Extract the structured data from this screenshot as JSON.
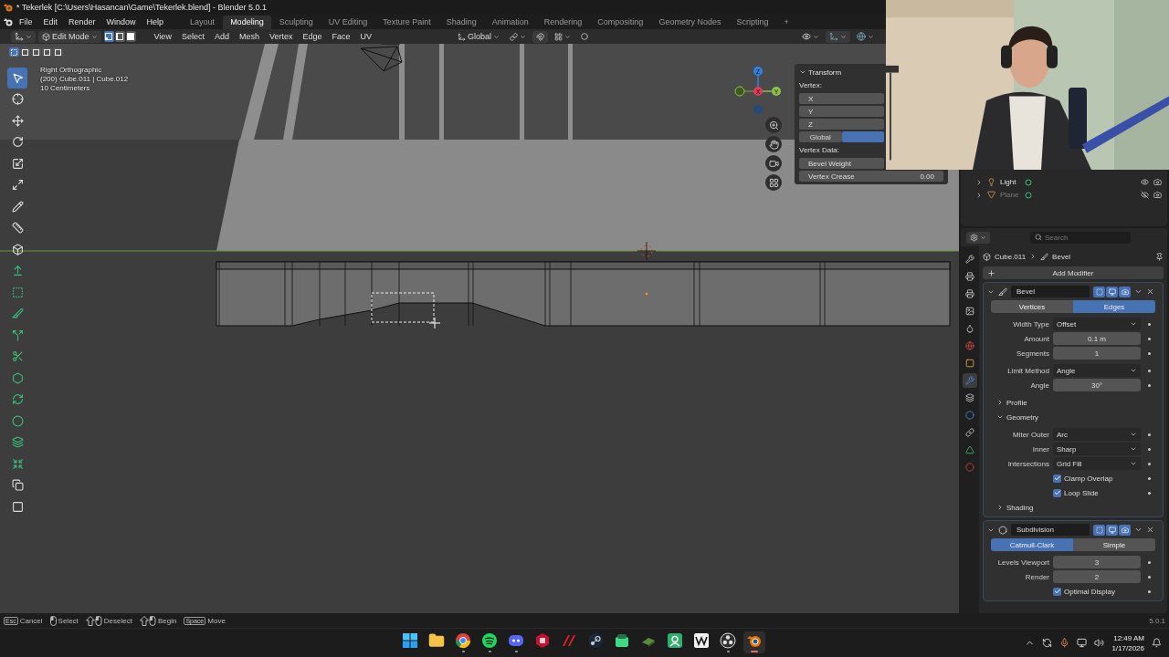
{
  "window": {
    "title": "* Tekerlek [C:\\Users\\Hasancan\\Game\\Tekerlek.blend] - Blender 5.0.1"
  },
  "menu": [
    "File",
    "Edit",
    "Render",
    "Window",
    "Help"
  ],
  "workspaces": [
    {
      "label": "Layout",
      "selected": false
    },
    {
      "label": "Modeling",
      "selected": true
    },
    {
      "label": "Sculpting",
      "selected": false
    },
    {
      "label": "UV Editing",
      "selected": false
    },
    {
      "label": "Texture Paint",
      "selected": false
    },
    {
      "label": "Shading",
      "selected": false
    },
    {
      "label": "Animation",
      "selected": false
    },
    {
      "label": "Rendering",
      "selected": false
    },
    {
      "label": "Compositing",
      "selected": false
    },
    {
      "label": "Geometry Nodes",
      "selected": false
    },
    {
      "label": "Scripting",
      "selected": false
    }
  ],
  "add_workspace": "+",
  "viewport": {
    "mode": "Edit Mode",
    "select_modes": [
      {
        "kind": "vertex",
        "selected": true
      },
      {
        "kind": "edge",
        "selected": false
      },
      {
        "kind": "face",
        "selected": false
      }
    ],
    "menus": [
      "View",
      "Select",
      "Add",
      "Mesh",
      "Vertex",
      "Edge",
      "Face",
      "UV"
    ],
    "orientation": "Global",
    "box_modes": [
      {
        "selected": true
      },
      {
        "selected": false
      },
      {
        "selected": false
      },
      {
        "selected": false
      },
      {
        "selected": false
      }
    ],
    "info": [
      "Right Orthographic",
      "(200) Cube.011 | Cube.012",
      "10 Centimeters"
    ],
    "gizmo_axes": [
      "X",
      "Y",
      "Z"
    ],
    "tools": [
      {
        "kind": "select",
        "selected": true
      },
      {
        "kind": "cursor",
        "selected": false
      },
      {
        "kind": "move",
        "selected": false
      },
      {
        "kind": "rotate",
        "selected": false
      },
      {
        "kind": "scale",
        "selected": false
      },
      {
        "kind": "transform",
        "selected": false
      },
      {
        "kind": "annotate",
        "selected": false
      },
      {
        "kind": "measure",
        "selected": false
      },
      {
        "kind": "add-cube",
        "selected": false
      },
      {
        "kind": "extrude",
        "selected": false
      },
      {
        "kind": "inset",
        "selected": false
      },
      {
        "kind": "bevel",
        "selected": false
      },
      {
        "kind": "loopcut",
        "selected": false
      },
      {
        "kind": "knife",
        "selected": false
      },
      {
        "kind": "polybuild",
        "selected": false
      },
      {
        "kind": "spin",
        "selected": false
      },
      {
        "kind": "smooth",
        "selected": false
      },
      {
        "kind": "slide",
        "selected": false
      },
      {
        "kind": "shrink",
        "selected": false
      },
      {
        "kind": "shear",
        "selected": false
      },
      {
        "kind": "rip",
        "selected": false
      }
    ]
  },
  "sidebar": {
    "title": "Transform",
    "vertex_label": "Vertex:",
    "fields": [
      "X",
      "Y",
      "Z"
    ],
    "space": [
      {
        "label": "Global",
        "selected": false
      },
      {
        "selected": true
      }
    ],
    "vertex_data_label": "Vertex Data:",
    "vertex_data": [
      {
        "label": "Bevel Weight"
      },
      {
        "label": "Vertex Crease",
        "value": "0.00"
      }
    ]
  },
  "outliner": [
    {
      "name": "Light",
      "kind": "light",
      "hidden": false
    },
    {
      "name": "Plane",
      "kind": "mesh",
      "hidden": true
    }
  ],
  "properties": {
    "search_placeholder": "Search",
    "tabs": [
      {
        "kind": "tool",
        "selected": false
      },
      {
        "kind": "render",
        "selected": false
      },
      {
        "kind": "output",
        "selected": false
      },
      {
        "kind": "view-layer",
        "selected": false
      },
      {
        "kind": "scene",
        "selected": false
      },
      {
        "kind": "world",
        "selected": false
      },
      {
        "kind": "object",
        "selected": false
      },
      {
        "kind": "modifiers",
        "selected": true
      },
      {
        "kind": "particles",
        "selected": false
      },
      {
        "kind": "physics",
        "selected": false
      },
      {
        "kind": "constraints",
        "selected": false
      },
      {
        "kind": "data",
        "selected": false
      },
      {
        "kind": "material",
        "selected": false
      }
    ],
    "breadcrumb": [
      "Cube.011",
      "Bevel"
    ],
    "add_modifier": "Add Modifier",
    "modifiers": [
      {
        "name": "Bevel",
        "kind": "bevel",
        "modes": [
          {
            "label": "Vertices",
            "selected": false
          },
          {
            "label": "Edges",
            "selected": true
          }
        ],
        "groups": [
          [
            {
              "kind": "dropdown",
              "label": "Width Type",
              "value": "Offset"
            },
            {
              "kind": "number",
              "label": "Amount",
              "value": "0.1 m"
            },
            {
              "kind": "number",
              "label": "Segments",
              "value": "1"
            }
          ],
          [
            {
              "kind": "dropdown",
              "label": "Limit Method",
              "value": "Angle"
            },
            {
              "kind": "number",
              "label": "Angle",
              "value": "30°"
            }
          ],
          [
            {
              "kind": "section",
              "label": "Profile",
              "expanded": false
            },
            {
              "kind": "section",
              "label": "Geometry",
              "expanded": true,
              "children": [
                {
                  "kind": "dropdown",
                  "label": "Miter Outer",
                  "value": "Arc"
                },
                {
                  "kind": "dropdown",
                  "label": "Inner",
                  "value": "Sharp"
                },
                {
                  "kind": "dropdown",
                  "label": "Intersections",
                  "value": "Grid Fill"
                },
                {
                  "kind": "checkbox",
                  "label": "Clamp Overlap",
                  "checked": true
                },
                {
                  "kind": "checkbox",
                  "label": "Loop Slide",
                  "checked": true
                }
              ]
            },
            {
              "kind": "section",
              "label": "Shading",
              "expanded": false
            }
          ]
        ]
      },
      {
        "name": "Subdivision",
        "kind": "subdivision",
        "modes": [
          {
            "label": "Catmull-Clark",
            "selected": true
          },
          {
            "label": "Simple",
            "selected": false
          }
        ],
        "groups": [
          [
            {
              "kind": "number",
              "label": "Levels Viewport",
              "value": "3"
            },
            {
              "kind": "number",
              "label": "Render",
              "value": "2"
            },
            {
              "kind": "checkbox",
              "label": "Optimal Display",
              "checked": true
            }
          ]
        ]
      }
    ]
  },
  "status_bar": {
    "hints": [
      {
        "kind": "key",
        "key": "Esc",
        "label": "Cancel"
      },
      {
        "kind": "mouse",
        "label": "Select"
      },
      {
        "kind": "shift-mouse",
        "label": "Deselect"
      },
      {
        "kind": "shift-mouse",
        "label": "Begin"
      },
      {
        "kind": "key",
        "key": "Space",
        "label": "Move"
      }
    ],
    "version": "5.0.1"
  },
  "taskbar": {
    "apps": [
      {
        "kind": "start",
        "running": false
      },
      {
        "kind": "folder",
        "running": false
      },
      {
        "kind": "chrome",
        "running": true
      },
      {
        "kind": "spotify",
        "running": true
      },
      {
        "kind": "discord",
        "running": true
      },
      {
        "kind": "red",
        "running": false
      },
      {
        "kind": "msi",
        "running": false
      },
      {
        "kind": "steam",
        "running": false
      },
      {
        "kind": "android",
        "running": false
      },
      {
        "kind": "board",
        "running": false
      },
      {
        "kind": "green",
        "running": false
      },
      {
        "kind": "wave",
        "running": false
      },
      {
        "kind": "obs",
        "running": true
      },
      {
        "kind": "blender",
        "running": true
      }
    ],
    "time": "12:49 AM",
    "date": "1/17/2026"
  }
}
